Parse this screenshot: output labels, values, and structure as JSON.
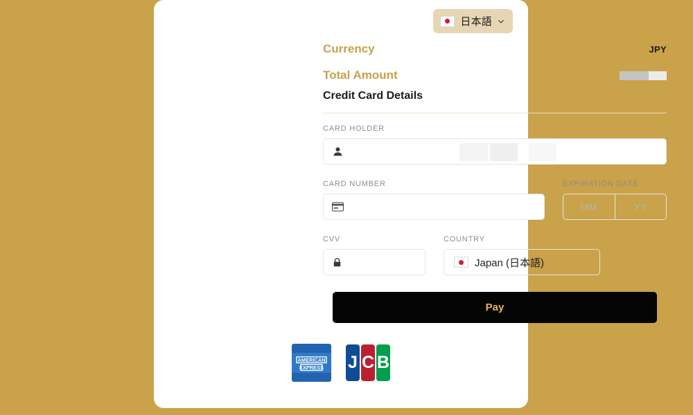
{
  "language_selector": {
    "label": "日本語",
    "flag_icon": "japan-flag-icon",
    "chevron_icon": "chevron-down-icon",
    "pill_color": "#e6d6b3"
  },
  "summary": {
    "currency_label": "Currency",
    "currency_value": "JPY",
    "total_amount_label": "Total Amount",
    "total_amount_value": "",
    "accent_color": "#c9a14a"
  },
  "section": {
    "title": "Credit Card Details"
  },
  "form": {
    "card_holder": {
      "label": "CARD HOLDER",
      "value": "",
      "placeholder": "",
      "icon": "person-icon"
    },
    "card_number": {
      "label": "CARD NUMBER",
      "value": "",
      "placeholder": "",
      "icon": "credit-card-icon"
    },
    "expiration": {
      "label": "EXPIRATION DATE",
      "month_placeholder": "MM",
      "month_value": "",
      "year_placeholder": "YY",
      "year_value": ""
    },
    "cvv": {
      "label": "CVV",
      "value": "",
      "placeholder": "",
      "icon": "lock-icon"
    },
    "country": {
      "label": "COUNTRY",
      "selected": "Japan (日本語)",
      "flag_icon": "japan-flag-icon"
    }
  },
  "pay_button": {
    "label": "Pay",
    "background": "#050505",
    "text_color": "#e8b84b"
  },
  "brands": [
    {
      "name": "American Express",
      "id": "amex-logo",
      "line1": "AMERICAN",
      "line2": "EXPRESS",
      "color": "#2264b0"
    },
    {
      "name": "JCB",
      "id": "jcb-logo",
      "letters": [
        "J",
        "C",
        "B"
      ],
      "colors": [
        "#0e4c96",
        "#bc2030",
        "#009f4d"
      ]
    }
  ],
  "page": {
    "background": "#c9a249"
  }
}
